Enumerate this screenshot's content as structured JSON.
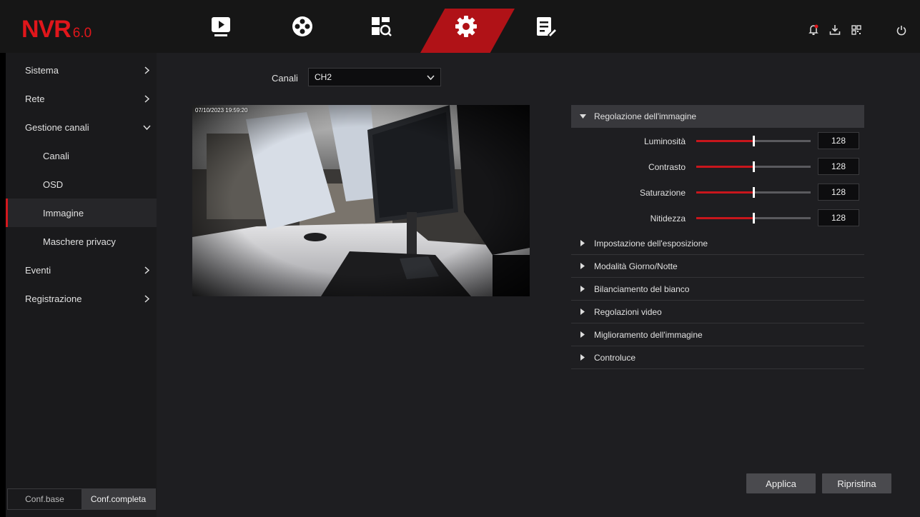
{
  "app": {
    "logo": "NVR",
    "version": "6.0"
  },
  "topnav": {
    "icons": [
      "play-icon",
      "film-reel-icon",
      "search-grid-icon",
      "settings-gear-icon",
      "maintenance-icon"
    ],
    "right_icons": [
      "notification-bell-icon",
      "download-icon",
      "qr-code-icon",
      "power-icon"
    ]
  },
  "sidebar": {
    "items": [
      {
        "label": "Sistema"
      },
      {
        "label": "Rete"
      },
      {
        "label": "Gestione canali"
      },
      {
        "label": "Canali"
      },
      {
        "label": "OSD"
      },
      {
        "label": "Immagine"
      },
      {
        "label": "Maschere privacy"
      },
      {
        "label": "Eventi"
      },
      {
        "label": "Registrazione"
      }
    ],
    "active": "Immagine",
    "mode_base": "Conf.base",
    "mode_full": "Conf.completa"
  },
  "channel": {
    "label": "Canali",
    "value": "CH2"
  },
  "preview": {
    "timestamp": "07/10/2023 19:59:20"
  },
  "image_adjust": {
    "title": "Regolazione dell'immagine",
    "sliders": [
      {
        "label": "Luminosità",
        "value": "128",
        "fraction": 0.5
      },
      {
        "label": "Contrasto",
        "value": "128",
        "fraction": 0.5
      },
      {
        "label": "Saturazione",
        "value": "128",
        "fraction": 0.5
      },
      {
        "label": "Nitidezza",
        "value": "128",
        "fraction": 0.5
      }
    ]
  },
  "sections": [
    "Impostazione dell'esposizione",
    "Modalità Giorno/Notte",
    "Bilanciamento del bianco",
    "Regolazioni video",
    "Miglioramento dell'immagine",
    "Controluce"
  ],
  "buttons": {
    "apply": "Applica",
    "reset": "Ripristina"
  },
  "colors": {
    "accent": "#d3181e",
    "background": "#1e1e21",
    "sidebar": "#1a1a1c",
    "topbar": "#161616"
  }
}
